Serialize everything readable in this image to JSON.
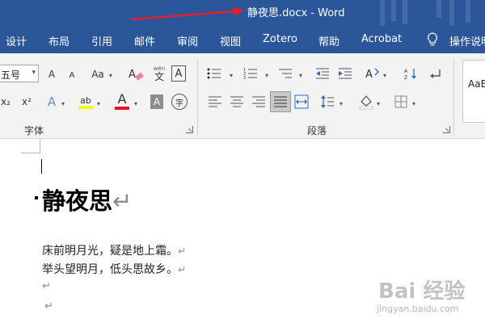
{
  "window": {
    "title": "静夜思.docx  -  Word",
    "accent_color": "#2b579a",
    "annotation_arrow_color": "#e0202a"
  },
  "ribbon_tabs": [
    "设计",
    "布局",
    "引用",
    "邮件",
    "审阅",
    "视图",
    "Zotero",
    "帮助",
    "Acrobat",
    "操作说明"
  ],
  "font_group": {
    "label": "字体",
    "font_size": "五号",
    "buttons": {
      "grow_font": "A",
      "shrink_font": "A",
      "change_case": "Aa",
      "phonetic_top": "wén",
      "phonetic_bottom": "文",
      "char_border": "A",
      "subscript": "x₂",
      "superscript": "x²",
      "text_effects": "A",
      "highlight": "ab",
      "font_color": "A",
      "char_shading": "A",
      "enclose_char": "字"
    },
    "highlight_color": "#ffff00",
    "font_color_bar": "#e81123"
  },
  "paragraph_group": {
    "label": "段落"
  },
  "styles_group": {
    "preview": "AaBb"
  },
  "document": {
    "heading": "静夜思",
    "lines": [
      "床前明月光，疑是地上霜。",
      "举头望明月，低头思故乡。"
    ],
    "paragraph_mark": "↵"
  },
  "watermark": {
    "logo": "Bai 经验",
    "url": "jingyan.baidu.com"
  }
}
